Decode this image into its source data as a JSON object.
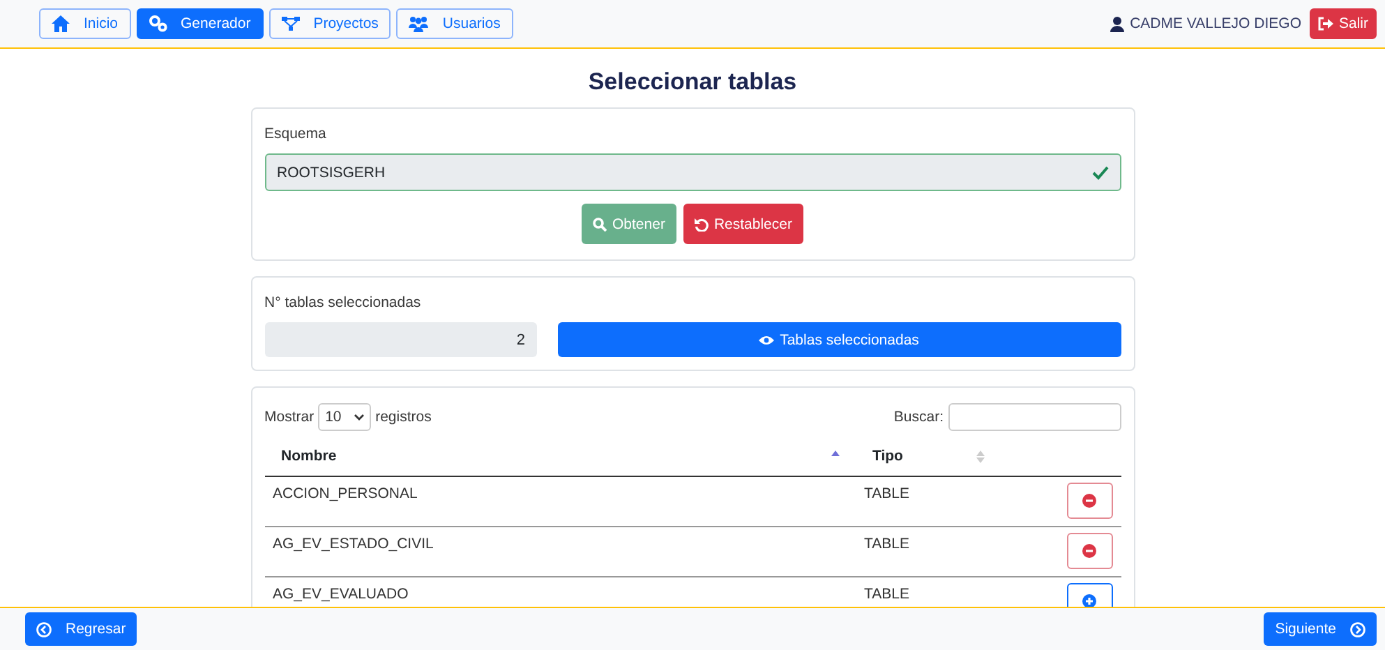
{
  "nav": {
    "items": [
      {
        "label": "Inicio",
        "kind": "home",
        "selected": false
      },
      {
        "label": "Generador",
        "kind": "gears",
        "selected": true
      },
      {
        "label": "Proyectos",
        "kind": "network",
        "selected": false
      },
      {
        "label": "Usuarios",
        "kind": "users",
        "selected": false
      }
    ],
    "user": "CADME VALLEJO DIEGO",
    "logout": "Salir"
  },
  "title": "Seleccionar tablas",
  "schema": {
    "label": "Esquema",
    "value": "ROOTSISGERH",
    "valid": true,
    "buttons": [
      {
        "label": "Obtener",
        "kind": "fetch"
      },
      {
        "label": "Restablecer",
        "kind": "reset"
      }
    ]
  },
  "count": {
    "label": "N° tablas seleccionadas",
    "value": "2",
    "button": "Tablas seleccionadas"
  },
  "table": {
    "show_prefix": "Mostrar",
    "page_size": "10",
    "show_suffix": "registros",
    "search_label": "Buscar:",
    "columns": [
      {
        "label": "Nombre",
        "sorted": true
      },
      {
        "label": "Tipo",
        "sorted": false
      }
    ],
    "rows": [
      {
        "name": "ACCION_PERSONAL",
        "type": "TABLE",
        "selected": true
      },
      {
        "name": "AG_EV_ESTADO_CIVIL",
        "type": "TABLE",
        "selected": true
      },
      {
        "name": "AG_EV_EVALUADO",
        "type": "TABLE",
        "selected": false
      }
    ]
  },
  "footer": {
    "back": "Regresar",
    "next": "Siguiente"
  }
}
